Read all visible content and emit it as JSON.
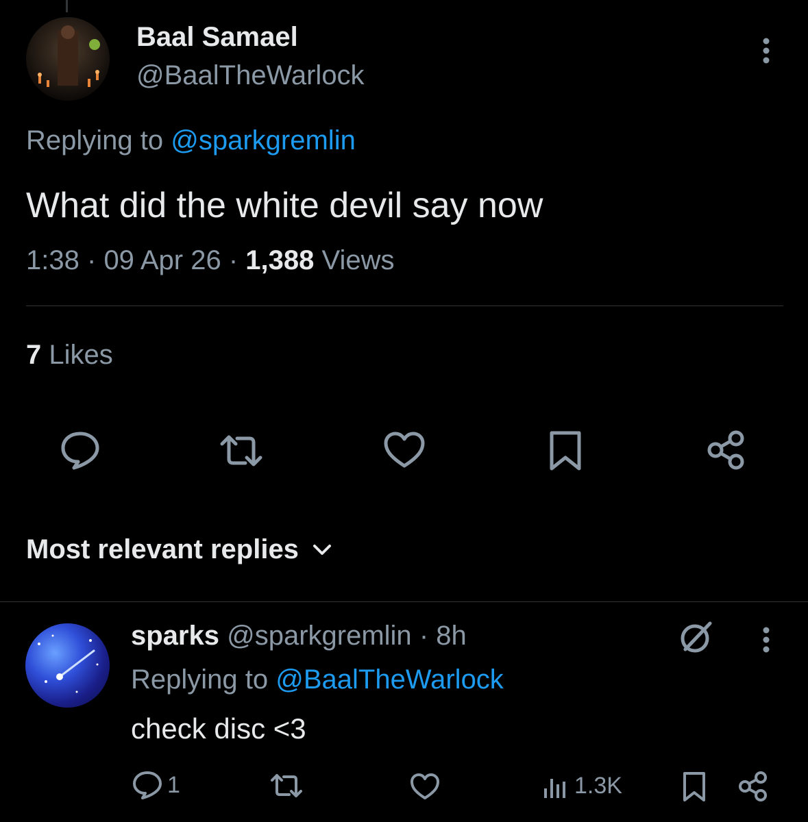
{
  "tweet": {
    "author_name": "Baal Samael",
    "author_handle": "@BaalTheWarlock",
    "replying_prefix": "Replying to",
    "replying_to": "@sparkgremlin",
    "text": "What did the white devil say now",
    "time": "1:38",
    "sep1": "·",
    "date": "09 Apr 26",
    "sep2": "·",
    "views_count": "1,388",
    "views_label": "Views",
    "likes_count": "7",
    "likes_label": "Likes"
  },
  "replies_sort": {
    "label": "Most relevant replies"
  },
  "reply": {
    "author_name": "sparks",
    "author_handle": "@sparkgremlin",
    "time": "· 8h",
    "replying_prefix": "Replying to",
    "replying_to": "@BaalTheWarlock",
    "text": "check disc <3",
    "reply_count": "1",
    "views": "1.3K"
  },
  "icons": {
    "overflow": "more-vertical-icon",
    "reply": "reply-icon",
    "retweet": "retweet-icon",
    "like": "heart-icon",
    "bookmark": "bookmark-icon",
    "share": "share-icon",
    "views": "views-icon",
    "muted": "circle-slash-icon",
    "chevron": "chevron-down-icon"
  },
  "colors": {
    "background": "#000000",
    "text": "#e7e9ea",
    "muted": "#8b98a5",
    "link": "#1d9bf0",
    "divider": "#2f3336"
  }
}
